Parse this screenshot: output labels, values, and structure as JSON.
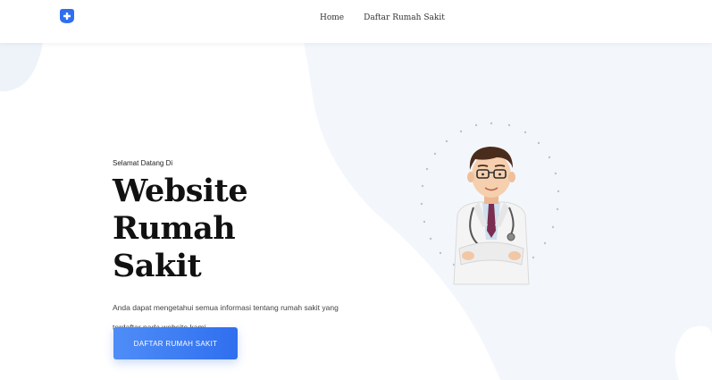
{
  "nav": {
    "logo_icon": "plus-shield-icon",
    "links": [
      "Home",
      "Daftar Rumah Sakit"
    ]
  },
  "hero": {
    "greeting": "Selamat Datang Di",
    "title_line1": "Website Rumah",
    "title_line2": "Sakit",
    "description": "Anda dapat mengetahui semua informasi tentang rumah sakit yang terdaftar pada website kami.",
    "cta_label": "DAFTAR RUMAH SAKIT",
    "illustration": "doctor-illustration"
  },
  "colors": {
    "accent": "#3b7cf5",
    "hero_bg": "#f3f7fc",
    "logo": "#2f6fef"
  }
}
